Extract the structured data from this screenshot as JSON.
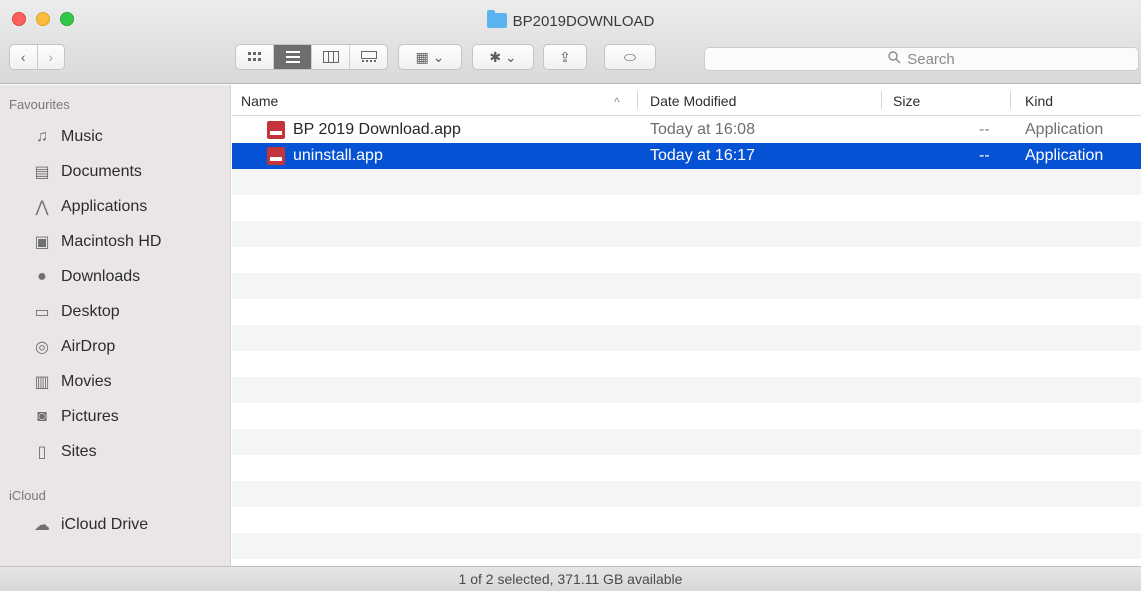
{
  "window": {
    "title": "BP2019DOWNLOAD"
  },
  "toolbar": {
    "back": "‹",
    "forward": "›",
    "views": [
      "icon-view-icon",
      "list-view-icon",
      "column-view-icon",
      "gallery-view-icon"
    ],
    "arrange_glyph": "▦ ⌄",
    "action_glyph": "✱ ⌄",
    "share_glyph": "⇪",
    "tags_glyph": "⬭",
    "search_placeholder": "Search"
  },
  "sidebar": {
    "favourites_header": "Favourites",
    "items": [
      {
        "label": "Music",
        "icon": "♫"
      },
      {
        "label": "Documents",
        "icon": "▤"
      },
      {
        "label": "Applications",
        "icon": "⋀"
      },
      {
        "label": "Macintosh HD",
        "icon": "▣"
      },
      {
        "label": "Downloads",
        "icon": "●"
      },
      {
        "label": "Desktop",
        "icon": "▭"
      },
      {
        "label": "AirDrop",
        "icon": "◎"
      },
      {
        "label": "Movies",
        "icon": "▥"
      },
      {
        "label": "Pictures",
        "icon": "◙"
      },
      {
        "label": "Sites",
        "icon": "▯"
      }
    ],
    "icloud_header": "iCloud",
    "icloud_items": [
      {
        "label": "iCloud Drive",
        "icon": "☁"
      }
    ]
  },
  "columns": {
    "name": "Name",
    "sort_indicator": "^",
    "date": "Date Modified",
    "size": "Size",
    "kind": "Kind"
  },
  "files": [
    {
      "name": "BP 2019 Download.app",
      "date": "Today at 16:08",
      "size": "--",
      "kind": "Application"
    },
    {
      "name": "uninstall.app",
      "date": "Today at 16:17",
      "size": "--",
      "kind": "Application"
    }
  ],
  "status": {
    "text": "1 of 2 selected, 371.11 GB available"
  },
  "colors": {
    "selection": "#0552d4",
    "app_icon": "#c4343b"
  }
}
